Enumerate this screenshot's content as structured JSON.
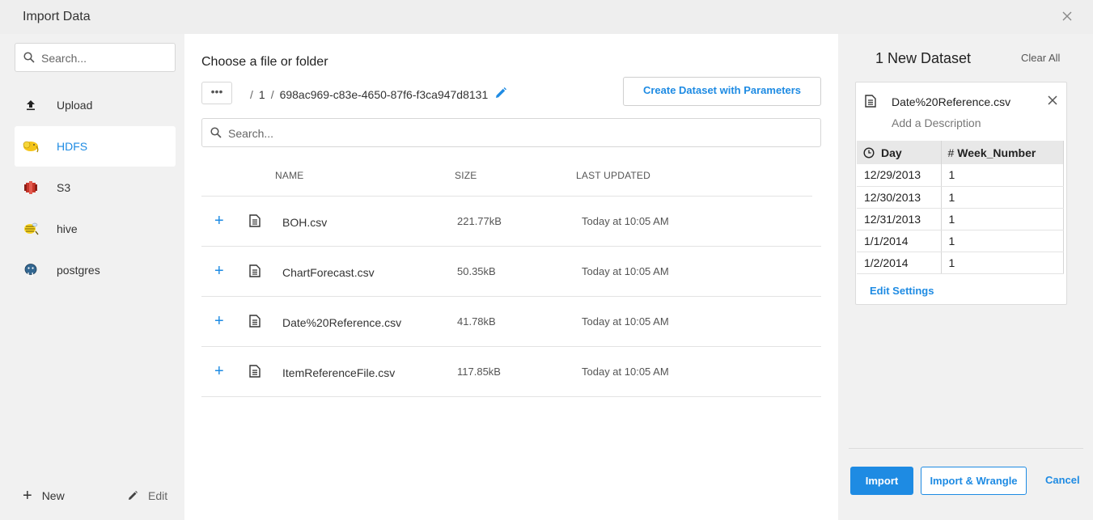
{
  "window": {
    "title": "Import Data",
    "close_icon": "close-icon"
  },
  "sidebar": {
    "search_placeholder": "Search...",
    "items": [
      {
        "label": "Upload",
        "icon": "upload-icon"
      },
      {
        "label": "HDFS",
        "icon": "hadoop-elephant-icon",
        "active": true
      },
      {
        "label": "S3",
        "icon": "s3-bucket-icon"
      },
      {
        "label": "hive",
        "icon": "hive-bee-icon"
      },
      {
        "label": "postgres",
        "icon": "postgres-elephant-icon"
      }
    ],
    "new_label": "New",
    "edit_label": "Edit"
  },
  "browser": {
    "heading": "Choose a file or folder",
    "more_button": "•••",
    "breadcrumb": [
      "1",
      "698ac969-c83e-4650-87f6-f3ca947d8131"
    ],
    "create_button": "Create Dataset with Parameters",
    "search_placeholder": "Search...",
    "columns": {
      "name": "NAME",
      "size": "SIZE",
      "updated": "LAST UPDATED"
    },
    "files": [
      {
        "name": "BOH.csv",
        "size": "221.77kB",
        "updated": "Today at 10:05 AM"
      },
      {
        "name": "ChartForecast.csv",
        "size": "50.35kB",
        "updated": "Today at 10:05 AM"
      },
      {
        "name": "Date%20Reference.csv",
        "size": "41.78kB",
        "updated": "Today at 10:05 AM"
      },
      {
        "name": "ItemReferenceFile.csv",
        "size": "117.85kB",
        "updated": "Today at 10:05 AM"
      }
    ]
  },
  "datasets": {
    "title": "1 New Dataset",
    "clear_all": "Clear All",
    "card": {
      "file_name": "Date%20Reference.csv",
      "description_placeholder": "Add a Description",
      "columns": [
        {
          "type_icon": "clock-icon",
          "name": "Day"
        },
        {
          "type_icon": "hash",
          "type_glyph": "#",
          "name": "Week_Number"
        }
      ],
      "rows": [
        [
          "12/29/2013",
          "1"
        ],
        [
          "12/30/2013",
          "1"
        ],
        [
          "12/31/2013",
          "1"
        ],
        [
          "1/1/2014",
          "1"
        ],
        [
          "1/2/2014",
          "1"
        ]
      ],
      "edit_settings": "Edit Settings"
    },
    "import_button": "Import",
    "import_wrangle_button": "Import & Wrangle",
    "cancel_button": "Cancel"
  },
  "colors": {
    "accent": "#1e8be3",
    "sidebar_bg": "#f1f1f1",
    "titlebar_bg": "#eeeeee"
  }
}
